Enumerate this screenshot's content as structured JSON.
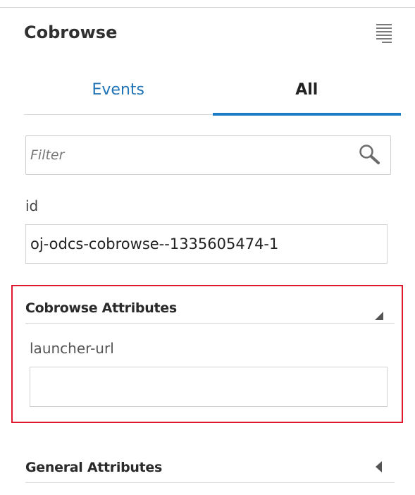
{
  "panel": {
    "title": "Cobrowse",
    "menu_icon": "hamburger-menu-icon"
  },
  "tabs": [
    {
      "label": "Events",
      "active": false
    },
    {
      "label": "All",
      "active": true
    }
  ],
  "filter": {
    "placeholder": "Filter",
    "value": "",
    "icon": "search-icon"
  },
  "id_field": {
    "label": "id",
    "value": "oj-odcs-cobrowse--1335605474-1"
  },
  "sections": {
    "cobrowse_attributes": {
      "title": "Cobrowse Attributes",
      "expanded": true,
      "fields": [
        {
          "label": "launcher-url",
          "value": ""
        }
      ]
    },
    "general_attributes": {
      "title": "General Attributes",
      "expanded": false
    }
  },
  "colors": {
    "accent": "#1a7cc4",
    "highlight_border": "#e0182e"
  }
}
